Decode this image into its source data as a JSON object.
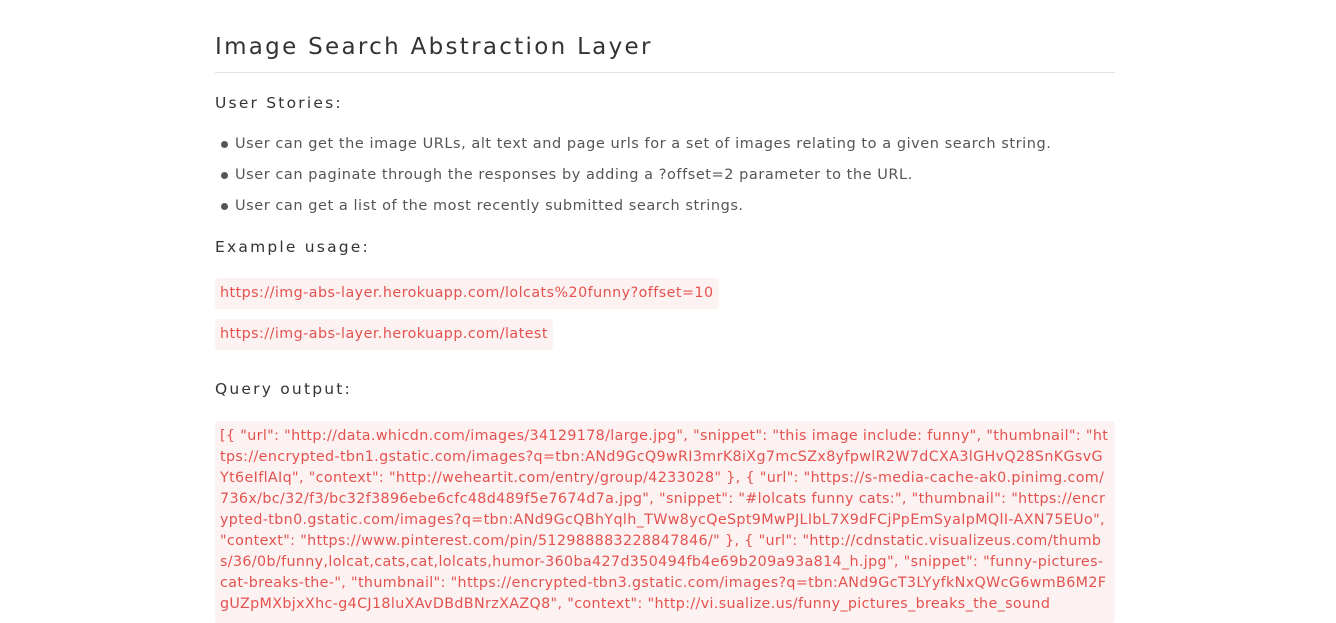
{
  "page": {
    "title": "Image Search Abstraction Layer"
  },
  "user_stories": {
    "heading": "User Stories:",
    "items": [
      "User can get the image URLs, alt text and page urls for a set of images relating to a given search string.",
      "User can paginate through the responses by adding a ?offset=2 parameter to the URL.",
      "User can get a list of the most recently submitted search strings."
    ]
  },
  "example_usage": {
    "heading": "Example usage:",
    "urls": [
      "https://img-abs-layer.herokuapp.com/lolcats%20funny?offset=10",
      "https://img-abs-layer.herokuapp.com/latest"
    ]
  },
  "query_output": {
    "heading": "Query output:",
    "text": "[{ \"url\": \"http://data.whicdn.com/images/34129178/large.jpg\", \"snippet\": \"this image include: funny\", \"thumbnail\": \"https://encrypted-tbn1.gstatic.com/images?q=tbn:ANd9GcQ9wRI3mrK8iXg7mcSZx8yfpwlR2W7dCXA3lGHvQ28SnKGsvGYt6eIflAIq\", \"context\": \"http://weheartit.com/entry/group/4233028\" }, { \"url\": \"https://s-media-cache-ak0.pinimg.com/736x/bc/32/f3/bc32f3896ebe6cfc48d489f5e7674d7a.jpg\", \"snippet\": \"#lolcats funny cats:\", \"thumbnail\": \"https://encrypted-tbn0.gstatic.com/images?q=tbn:ANd9GcQBhYqlh_TWw8ycQeSpt9MwPJLIbL7X9dFCjPpEmSyaIpMQlI-AXN75EUo\", \"context\": \"https://www.pinterest.com/pin/512988883228847846/\" }, { \"url\": \"http://cdnstatic.visualizeus.com/thumbs/36/0b/funny,lolcat,cats,cat,lolcats,humor-360ba427d350494fb4e69b209a93a814_h.jpg\", \"snippet\": \"funny-pictures-cat-breaks-the-\", \"thumbnail\": \"https://encrypted-tbn3.gstatic.com/images?q=tbn:ANd9GcT3LYyfkNxQWcG6wmB6M2FgUZpMXbjxXhc-g4CJ18luXAvDBdBNrzXAZQ8\", \"context\": \"http://vi.sualize.us/funny_pictures_breaks_the_sound"
  }
}
